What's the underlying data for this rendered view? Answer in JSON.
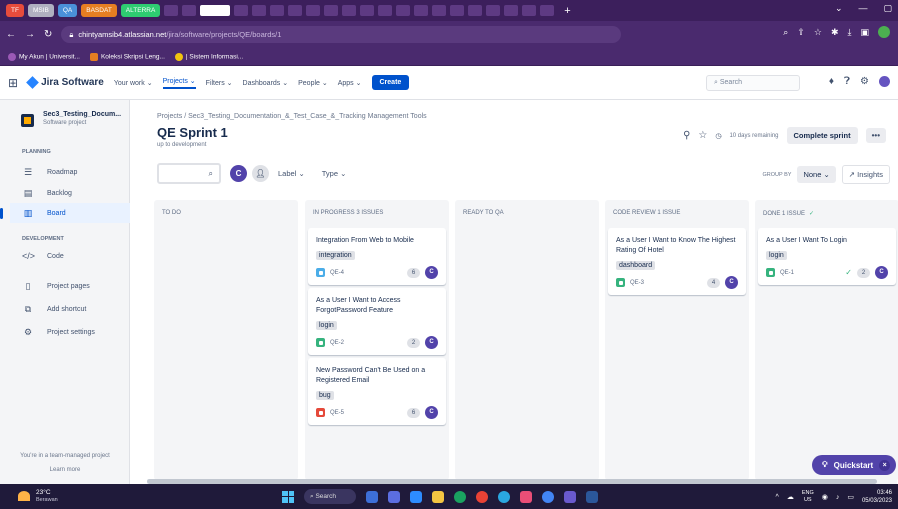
{
  "browser": {
    "tabs": [
      "TF",
      "MSIB",
      "QA",
      "BASDAT",
      "ALTERRA"
    ],
    "tab_colors": [
      "#e74c3c",
      "#b0b0c0",
      "#4a90d9",
      "#e67e22",
      "#2ecc71"
    ],
    "new_tab": "+",
    "url_host": "chintyamsib4.atlassian.net",
    "url_path": "/jira/software/projects/QE/boards/1",
    "bookmarks": [
      "My Akun | Universit...",
      "Koleksi Skripsi Leng...",
      "| Sistem Informasi..."
    ]
  },
  "jira_nav": {
    "product": "Jira Software",
    "items": [
      "Your work",
      "Projects",
      "Filters",
      "Dashboards",
      "People",
      "Apps"
    ],
    "create": "Create",
    "search_placeholder": "Search",
    "avatar_initial": "C"
  },
  "sidebar": {
    "project_name": "Sec3_Testing_Docum...",
    "project_type": "Software project",
    "planning_label": "PLANNING",
    "planning": [
      {
        "label": "Roadmap",
        "icon": "roadmap-icon"
      },
      {
        "label": "Backlog",
        "icon": "backlog-icon"
      },
      {
        "label": "Board",
        "icon": "board-icon"
      }
    ],
    "development_label": "DEVELOPMENT",
    "development": [
      {
        "label": "Code",
        "icon": "code-icon"
      }
    ],
    "other": [
      {
        "label": "Project pages",
        "icon": "pages-icon"
      },
      {
        "label": "Add shortcut",
        "icon": "shortcut-icon"
      },
      {
        "label": "Project settings",
        "icon": "settings-icon"
      }
    ],
    "footer_text": "You're in a team-managed project",
    "footer_link": "Learn more"
  },
  "board": {
    "breadcrumb": "Projects  /  Sec3_Testing_Documentation_&_Test_Case_&_Tracking Management Tools",
    "title": "QE Sprint 1",
    "subtitle": "up to development",
    "remaining": "10 days remaining",
    "complete_sprint": "Complete sprint",
    "more": "•••",
    "filter_avatar": "C",
    "label_filter": "Label",
    "type_filter": "Type",
    "group_by_label": "GROUP BY",
    "group_by_value": "None",
    "insights": "Insights",
    "columns": [
      {
        "title": "TO DO",
        "cards": []
      },
      {
        "title": "IN PROGRESS 3 ISSUES",
        "cards": [
          {
            "title": "Integration From Web to Mobile",
            "label": "integration",
            "key": "QE-4",
            "type": "task",
            "estimate": "6",
            "assignee": "C"
          },
          {
            "title": "As a User I Want to Access ForgotPassword Feature",
            "label": "login",
            "key": "QE-2",
            "type": "story",
            "estimate": "2",
            "assignee": "C"
          },
          {
            "title": "New Password Can't Be Used on a Registered Email",
            "label": "bug",
            "key": "QE-5",
            "type": "bug",
            "estimate": "6",
            "assignee": "C"
          }
        ]
      },
      {
        "title": "READY TO QA",
        "cards": []
      },
      {
        "title": "CODE REVIEW 1 ISSUE",
        "cards": [
          {
            "title": "As a User I Want to Know The Highest Rating Of Hotel",
            "label": "dashboard",
            "key": "QE-3",
            "type": "story",
            "estimate": "4",
            "assignee": "C"
          }
        ]
      },
      {
        "title": "DONE 1 ISSUE",
        "cards": [
          {
            "title": "As a User I Want To Login",
            "label": "login",
            "key": "QE-1",
            "type": "story",
            "estimate": "2",
            "assignee": "C",
            "done": true
          }
        ]
      }
    ]
  },
  "quickstart": {
    "label": "Quickstart",
    "close": "×"
  },
  "taskbar": {
    "temp": "23°C",
    "condition": "Berawan",
    "search": "Search",
    "lang": "ENG",
    "region": "US",
    "time": "03:46",
    "date": "05/03/2023"
  }
}
